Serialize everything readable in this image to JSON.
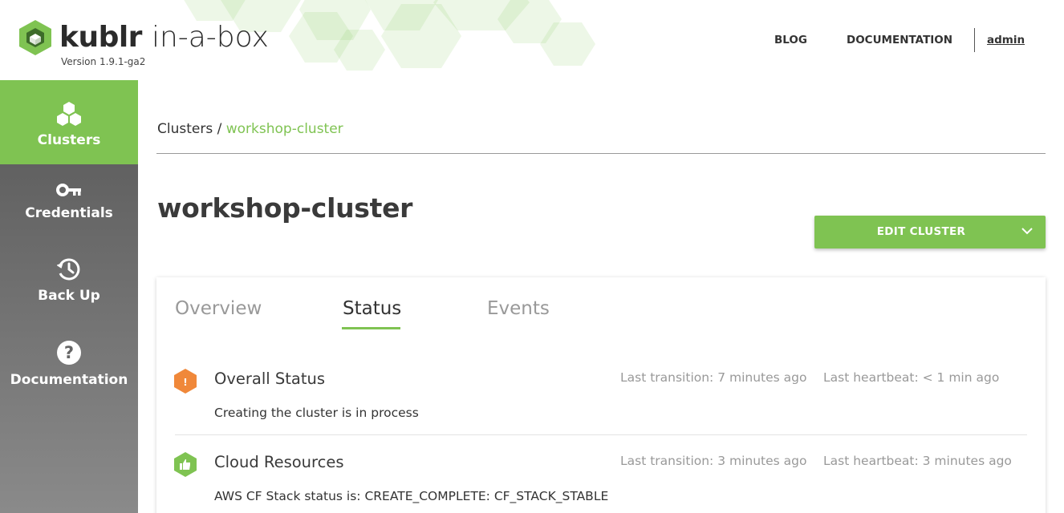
{
  "brand": {
    "name": "kublr",
    "suffix": "in-a-box",
    "version": "Version 1.9.1-ga2"
  },
  "topnav": {
    "items": [
      "BLOG",
      "DOCUMENTATION"
    ],
    "user": "admin"
  },
  "sidebar": {
    "items": [
      {
        "label": "Clusters",
        "icon": "hexagons-icon",
        "active": true
      },
      {
        "label": "Credentials",
        "icon": "key-icon",
        "active": false
      },
      {
        "label": "Back Up",
        "icon": "history-icon",
        "active": false
      },
      {
        "label": "Documentation",
        "icon": "question-circle-icon",
        "active": false
      }
    ]
  },
  "breadcrumb": {
    "root": "Clusters",
    "separator": " / ",
    "current": "workshop-cluster"
  },
  "page": {
    "title": "workshop-cluster",
    "edit_button": "EDIT CLUSTER"
  },
  "tabs": [
    {
      "label": "Overview",
      "active": false
    },
    {
      "label": "Status",
      "active": true
    },
    {
      "label": "Events",
      "active": false
    }
  ],
  "status_rows": [
    {
      "title": "Overall Status",
      "message": "Creating the cluster is in process",
      "last_transition": "Last transition: 7 minutes ago",
      "last_heartbeat": "Last heartbeat: < 1 min ago",
      "icon": "warning-hex-icon",
      "color": "#f0883a"
    },
    {
      "title": "Cloud Resources",
      "message": "AWS CF Stack status is: CREATE_COMPLETE: CF_STACK_STABLE",
      "last_transition": "Last transition: 3 minutes ago",
      "last_heartbeat": "Last heartbeat: 3 minutes ago",
      "icon": "thumbs-up-hex-icon",
      "color": "#7fc352"
    }
  ],
  "colors": {
    "accent": "#7fc352",
    "warning": "#f0883a",
    "sidebar_top": "#575757",
    "sidebar_bottom": "#8a8a8a"
  }
}
